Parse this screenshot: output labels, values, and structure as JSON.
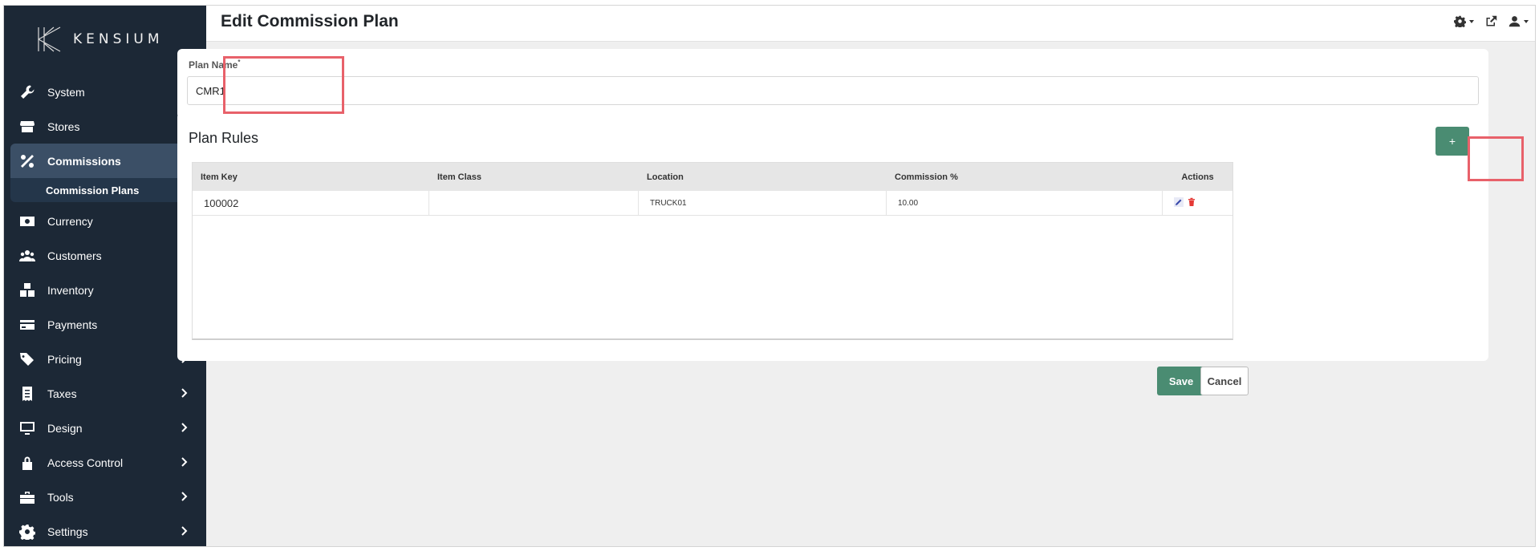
{
  "brand": {
    "name": "KENSIUM"
  },
  "header": {
    "title": "Edit Commission Plan"
  },
  "sidebar": {
    "items": [
      {
        "label": "System",
        "icon": "wrench-icon"
      },
      {
        "label": "Stores",
        "icon": "store-icon"
      },
      {
        "label": "Commissions",
        "icon": "percent-icon",
        "expanded": true
      },
      {
        "label": "Currency",
        "icon": "money-icon"
      },
      {
        "label": "Customers",
        "icon": "users-icon"
      },
      {
        "label": "Inventory",
        "icon": "boxes-icon"
      },
      {
        "label": "Payments",
        "icon": "credit-card-icon"
      },
      {
        "label": "Pricing",
        "icon": "tags-icon"
      },
      {
        "label": "Taxes",
        "icon": "receipt-icon"
      },
      {
        "label": "Design",
        "icon": "monitor-icon"
      },
      {
        "label": "Access Control",
        "icon": "lock-icon"
      },
      {
        "label": "Tools",
        "icon": "toolbox-icon"
      },
      {
        "label": "Settings",
        "icon": "gear-icon"
      }
    ],
    "subitem": {
      "label": "Commission Plans"
    }
  },
  "plan": {
    "label": "Plan Name",
    "required_mark": "*",
    "value": "CMR1"
  },
  "rules": {
    "title": "Plan Rules",
    "add_label": "+",
    "columns": [
      "Item Key",
      "Item Class",
      "Location",
      "Commission %",
      "Actions"
    ],
    "rows": [
      {
        "item_key": "100002",
        "item_class": "",
        "location": "TRUCK01",
        "commission": "10.00"
      }
    ]
  },
  "footer": {
    "save_label": "Save",
    "cancel_label": "Cancel"
  },
  "colors": {
    "sidebar": "#1c2836",
    "accent": "#4a8c72",
    "highlight": "#e8616a"
  }
}
